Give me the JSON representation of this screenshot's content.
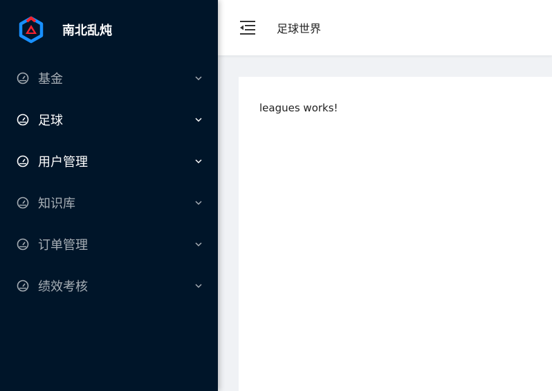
{
  "brand": {
    "name": "南北乱炖"
  },
  "menu": [
    {
      "label": "基金",
      "active": false
    },
    {
      "label": "足球",
      "active": true
    },
    {
      "label": "用户管理",
      "active": true
    },
    {
      "label": "知识库",
      "active": false
    },
    {
      "label": "订单管理",
      "active": false
    },
    {
      "label": "绩效考核",
      "active": false
    }
  ],
  "header": {
    "title": "足球世界"
  },
  "content": {
    "text": "leagues works!"
  },
  "colors": {
    "sider": "#001529",
    "accent_blue": "#1890ff",
    "accent_red": "#f5222d",
    "page_bg": "#f0f2f5"
  }
}
